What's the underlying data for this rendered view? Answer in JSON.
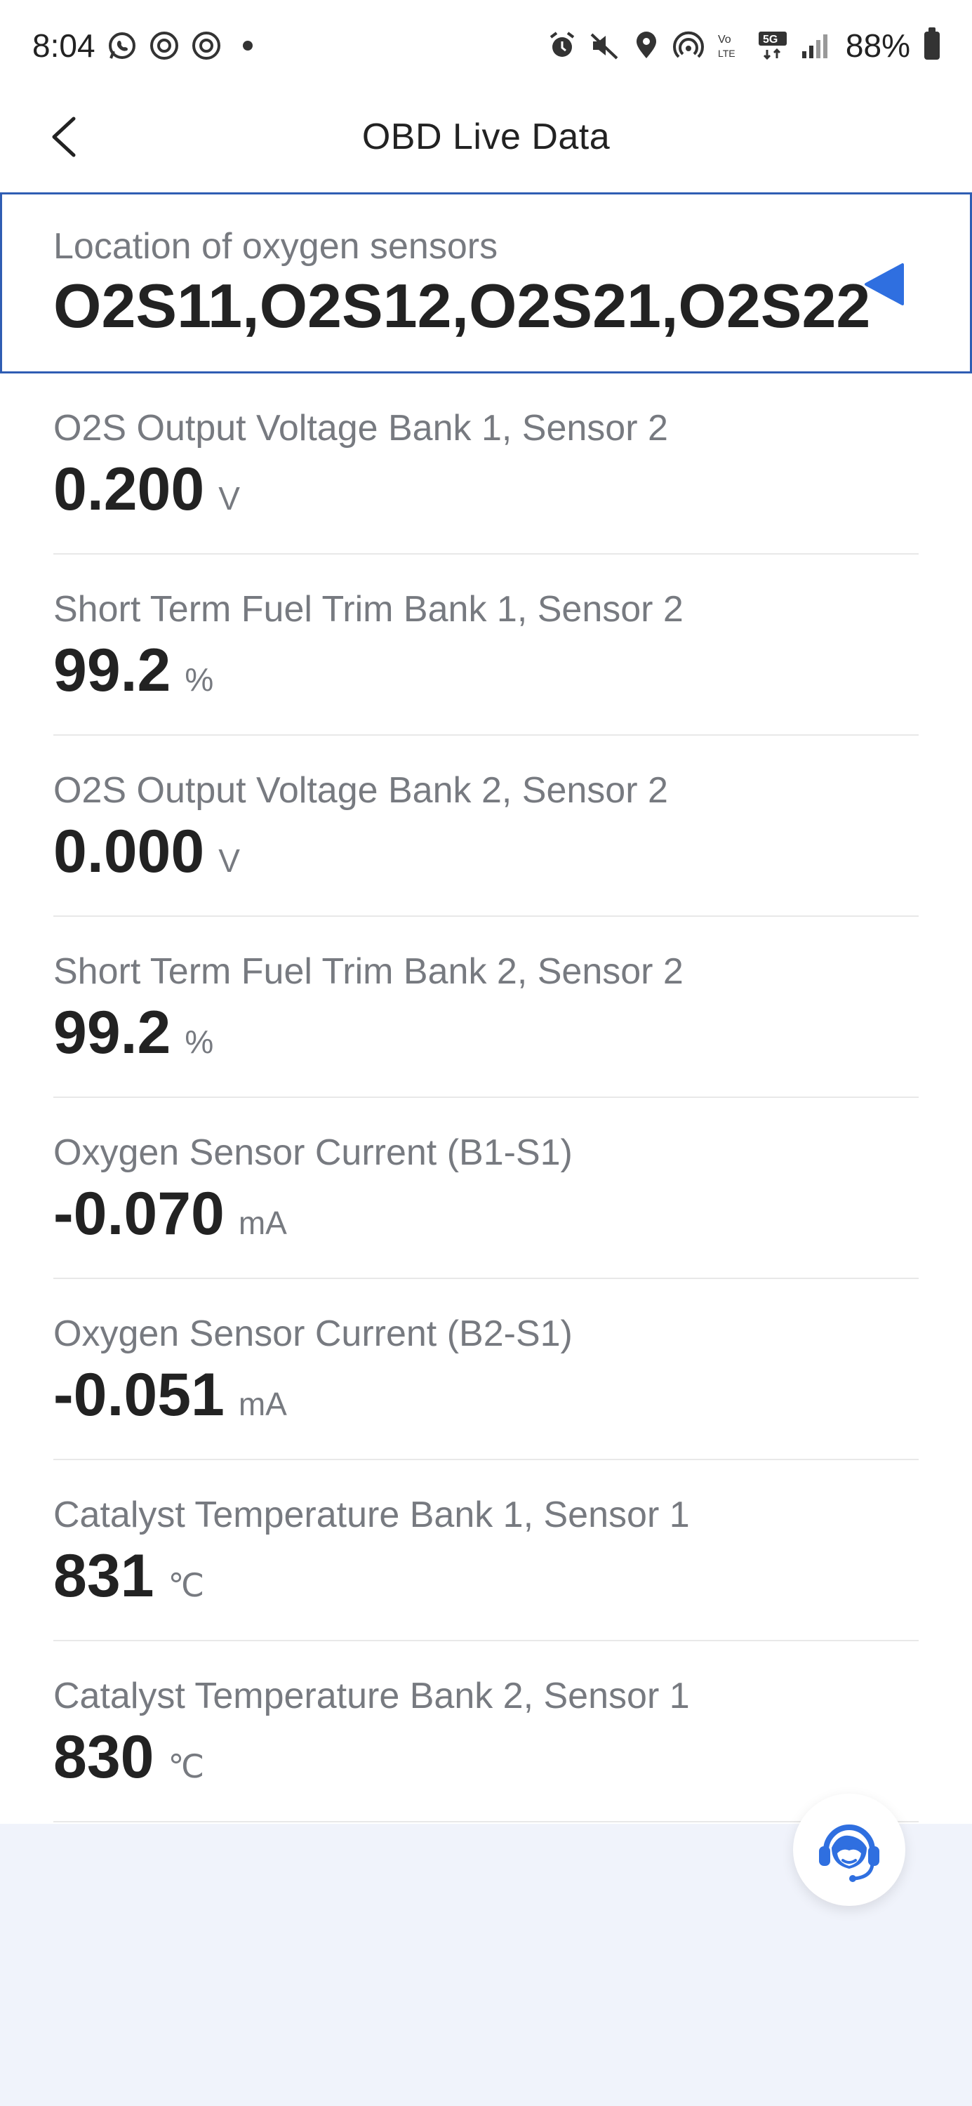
{
  "status_bar": {
    "time": "8:04",
    "battery": "88%",
    "network_label": "5G",
    "lte_label": "LTE"
  },
  "header": {
    "title": "OBD Live Data"
  },
  "selected_item": {
    "label": "Location of oxygen sensors",
    "value": "O2S11,O2S12,O2S21,O2S22"
  },
  "items": [
    {
      "label": "O2S Output Voltage Bank 1, Sensor 2",
      "value": "0.200",
      "unit": "V"
    },
    {
      "label": "Short Term Fuel Trim Bank 1, Sensor 2",
      "value": "99.2",
      "unit": "%"
    },
    {
      "label": "O2S Output Voltage Bank 2, Sensor 2",
      "value": "0.000",
      "unit": "V"
    },
    {
      "label": "Short Term Fuel Trim Bank 2, Sensor 2",
      "value": "99.2",
      "unit": "%"
    },
    {
      "label": "Oxygen Sensor Current (B1-S1)",
      "value": "-0.070",
      "unit": "mA"
    },
    {
      "label": "Oxygen Sensor Current (B2-S1)",
      "value": "-0.051",
      "unit": "mA"
    },
    {
      "label": "Catalyst Temperature Bank 1, Sensor 1",
      "value": "831",
      "unit": "℃"
    },
    {
      "label": "Catalyst Temperature Bank 2, Sensor 1",
      "value": "830",
      "unit": "℃"
    }
  ],
  "colors": {
    "accent": "#2f6fe0",
    "selected_border": "#2f5db3",
    "label_gray": "#777a80",
    "bottom_bg": "#f0f3fb"
  }
}
